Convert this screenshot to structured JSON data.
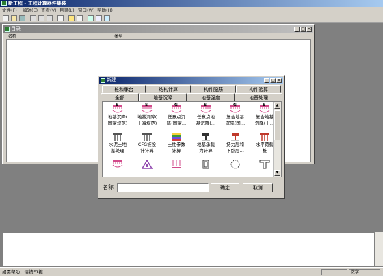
{
  "app": {
    "title": "新工程 - 工程计算器件集装"
  },
  "menu": [
    "文件(F)",
    "编辑(E)",
    "查看(V)",
    "目录(L)",
    "窗口(W)",
    "帮助(H)"
  ],
  "toolbar_icons": [
    "new-icon",
    "open-icon",
    "save-icon",
    "cut-icon",
    "copy-icon",
    "paste-icon",
    "print-icon",
    "help-icon",
    "context-help-icon",
    "calc-icon",
    "table-icon",
    "chart-icon"
  ],
  "catalog": {
    "title": "目录",
    "columns": [
      "名称",
      "类型"
    ]
  },
  "dialog": {
    "title": "新建",
    "tabs_back": [
      "桩和承台",
      "结构计算",
      "构件配筋",
      "构件验算"
    ],
    "tabs_front": [
      "全部",
      "地基沉降",
      "地基强度",
      "地基处理"
    ],
    "items": [
      {
        "label": "地基沉降(国家规范)",
        "l1": "地基沉降(",
        "l2": "国家规范)",
        "icon": "settlement-icon",
        "color": "#d24a8a",
        "letter": "S"
      },
      {
        "label": "地基沉降(上海规范)",
        "l1": "地基沉降(",
        "l2": "上海规范)",
        "icon": "settlement-icon",
        "color": "#d24a8a",
        "letter": "S"
      },
      {
        "label": "任意点沉降(国家…",
        "l1": "任意点沉",
        "l2": "降(国家…",
        "icon": "settlement-icon",
        "color": "#d24a8a",
        "letter": "G"
      },
      {
        "label": "任意点地基沉降(…",
        "l1": "任意点地",
        "l2": "基沉降(…",
        "icon": "settlement-icon",
        "color": "#d24a8a",
        "letter": "S"
      },
      {
        "label": "复合地基沉降(国…",
        "l1": "复合地基",
        "l2": "沉降(国…",
        "icon": "settlement-icon",
        "color": "#d24a8a",
        "letter": "G"
      },
      {
        "label": "复合地基沉降(上…",
        "l1": "复合地基",
        "l2": "沉降(上…",
        "icon": "settlement-icon",
        "color": "#d24a8a",
        "letter": "S"
      },
      {
        "label": "水泥土地基处理",
        "l1": "水泥土地",
        "l2": "基处理",
        "icon": "pile-icon",
        "color": "#555555",
        "letter": ""
      },
      {
        "label": "CFG桩设计计算",
        "l1": "CFG桩设",
        "l2": "计计算",
        "icon": "pile-icon",
        "color": "#555555",
        "letter": ""
      },
      {
        "label": "土性参数计算",
        "l1": "土性参数",
        "l2": "计算",
        "icon": "soil-layers-icon",
        "color": "#3a9a3a",
        "letter": ""
      },
      {
        "label": "地基承载力计算",
        "l1": "地基承载",
        "l2": "力计算",
        "icon": "bearing-icon",
        "color": "#333333",
        "letter": ""
      },
      {
        "label": "持力层和下卧层…",
        "l1": "持力层和",
        "l2": "下卧层…",
        "icon": "bearing-icon",
        "color": "#c0392b",
        "letter": ""
      },
      {
        "label": "水平荷载桩",
        "l1": "水平荷载",
        "l2": "桩",
        "icon": "pile-icon",
        "color": "#c0392b",
        "letter": ""
      },
      {
        "label": "",
        "l1": "",
        "l2": "",
        "icon": "settlement-icon",
        "color": "#d24a8a",
        "letter": ""
      },
      {
        "label": "",
        "l1": "",
        "l2": "",
        "icon": "triangle-icon",
        "color": "#8e44ad",
        "letter": ""
      },
      {
        "label": "",
        "l1": "",
        "l2": "",
        "icon": "load-icon",
        "color": "#d24a8a",
        "letter": ""
      },
      {
        "label": "",
        "l1": "",
        "l2": "",
        "icon": "section-icon",
        "color": "#333333",
        "letter": ""
      },
      {
        "label": "",
        "l1": "",
        "l2": "",
        "icon": "circle-section-icon",
        "color": "#333333",
        "letter": ""
      },
      {
        "label": "",
        "l1": "",
        "l2": "",
        "icon": "t-beam-icon",
        "color": "#333333",
        "letter": ""
      }
    ],
    "name_label": "名称",
    "name_value": "",
    "ok_label": "确定",
    "cancel_label": "取消"
  },
  "status": {
    "text": "如需帮助，请按F1键",
    "num": "数字"
  }
}
